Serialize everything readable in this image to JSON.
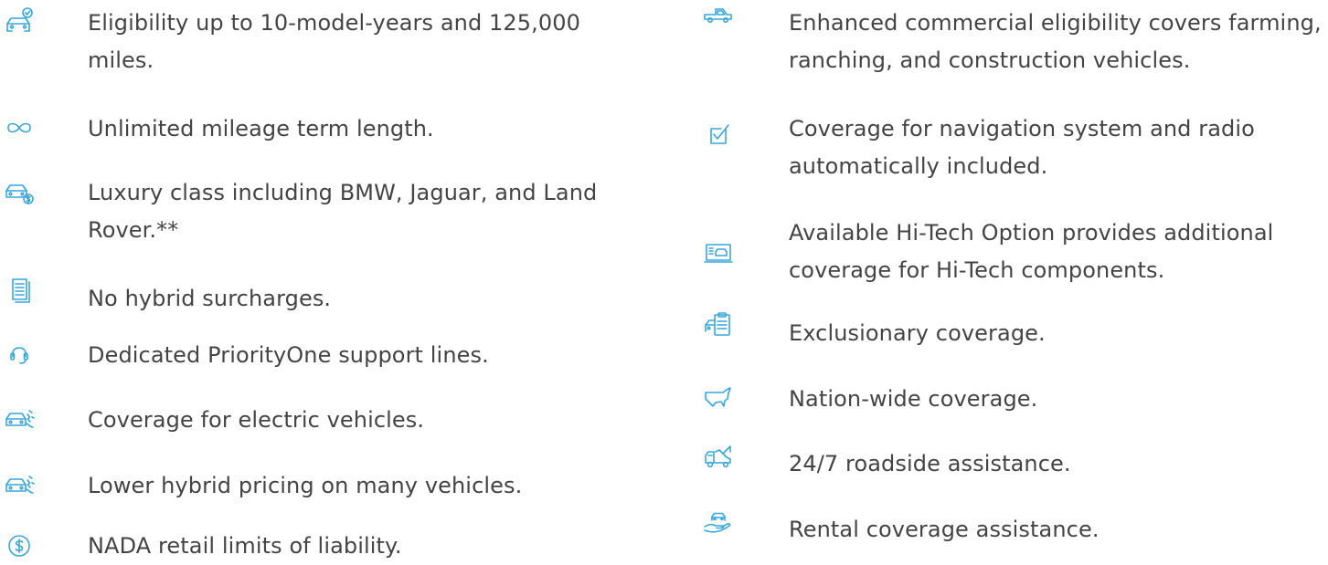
{
  "accent_color": "#3aa6d8",
  "text_color": "#444444",
  "left_features": [
    {
      "icon": "car-check-icon",
      "text": "Eligibility up to 10-model-years and 125,000 miles."
    },
    {
      "icon": "infinity-icon",
      "text": "Unlimited mileage term length."
    },
    {
      "icon": "car-dollar-icon",
      "text": "Luxury class including BMW, Jaguar, and Land Rover.**"
    },
    {
      "icon": "documents-icon",
      "text": "No hybrid surcharges."
    },
    {
      "icon": "headset-icon",
      "text": "Dedicated PriorityOne support lines."
    },
    {
      "icon": "electric-car-icon",
      "text": "Coverage for electric vehicles."
    },
    {
      "icon": "electric-car-icon",
      "text": "Lower hybrid pricing on many vehicles."
    },
    {
      "icon": "dollar-circle-icon",
      "text": "NADA retail limits of liability."
    }
  ],
  "right_features": [
    {
      "icon": "pickup-truck-icon",
      "text": "Enhanced commercial eligibility covers farming, ranching, and construction vehicles."
    },
    {
      "icon": "checkbox-icon",
      "text": "Coverage for navigation system and radio automatically included."
    },
    {
      "icon": "car-screen-icon",
      "text": "Available Hi-Tech Option provides additional coverage for Hi-Tech components."
    },
    {
      "icon": "car-clipboard-icon",
      "text": "Exclusionary coverage."
    },
    {
      "icon": "usa-map-icon",
      "text": "Nation-wide coverage."
    },
    {
      "icon": "tow-truck-icon",
      "text": "24/7 roadside assistance."
    },
    {
      "icon": "hand-car-icon",
      "text": "Rental coverage assistance."
    }
  ]
}
